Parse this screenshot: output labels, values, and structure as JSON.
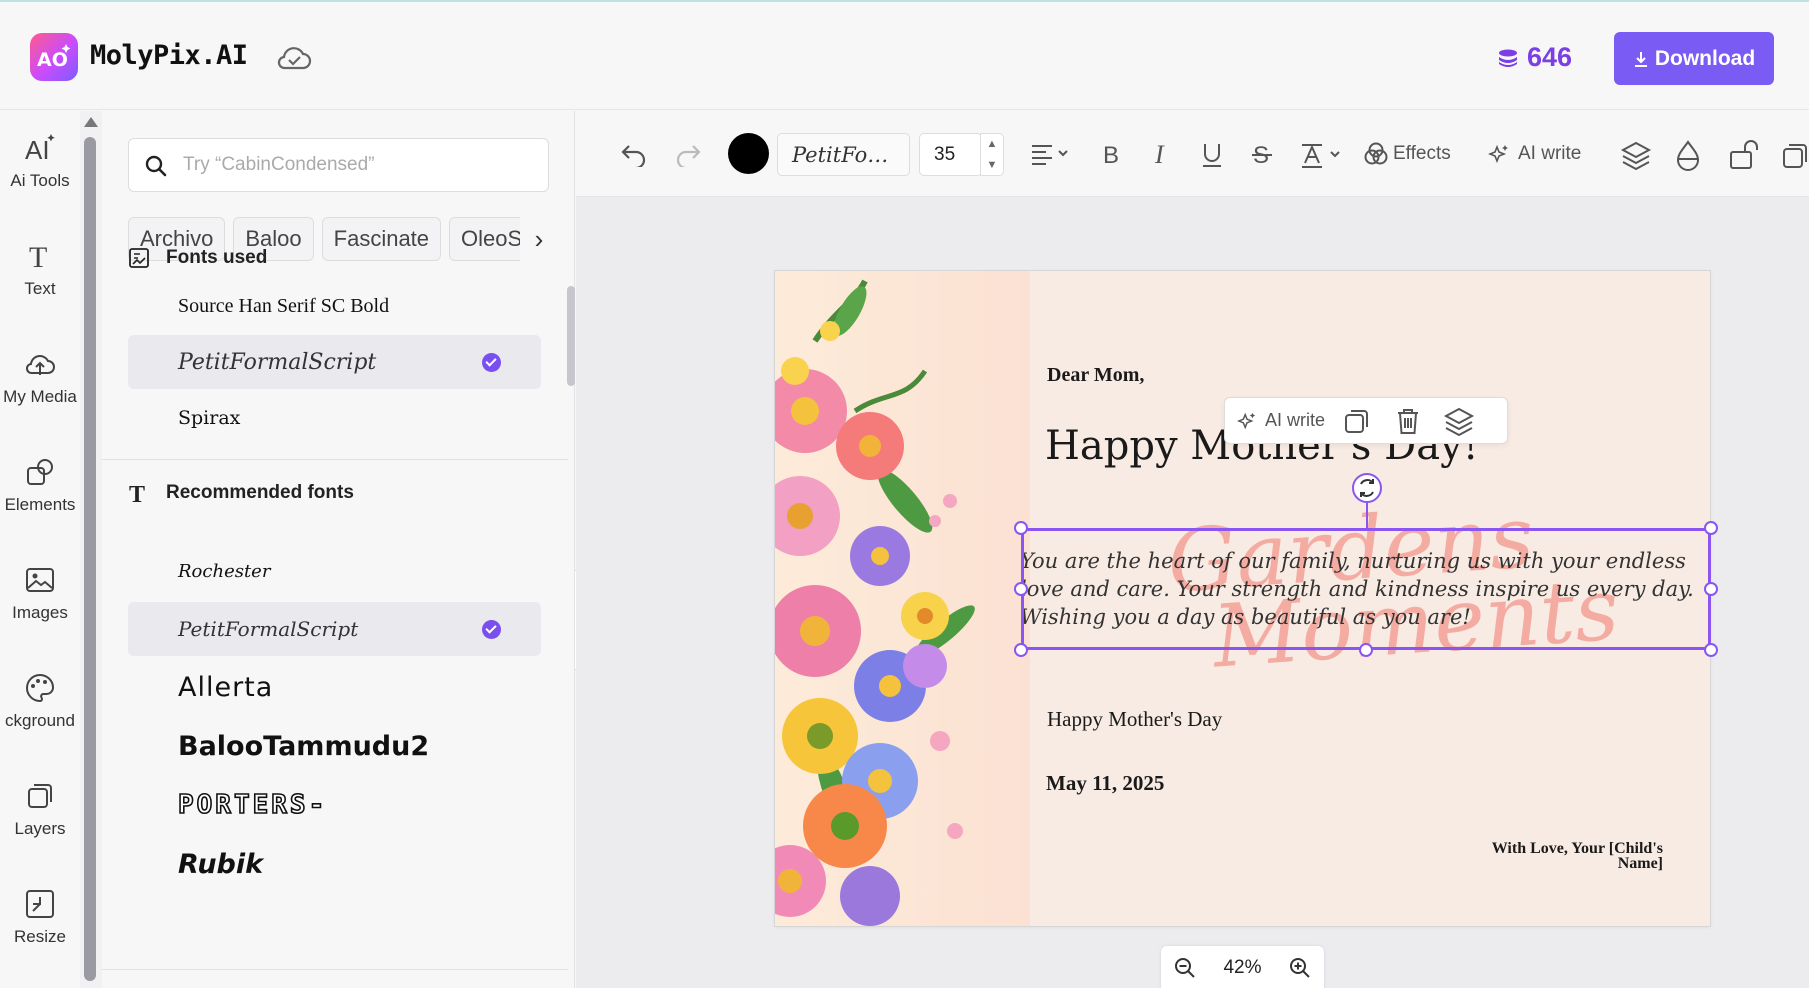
{
  "header": {
    "app_name": "MolyPix.AI",
    "logo_mark": "AO",
    "credits": "646",
    "download_label": "Download"
  },
  "rail": {
    "items": [
      {
        "label": "Ai Tools",
        "icon": "ai-tools-icon"
      },
      {
        "label": "Text",
        "icon": "text-icon"
      },
      {
        "label": "My Media",
        "icon": "upload-cloud-icon"
      },
      {
        "label": "Elements",
        "icon": "elements-icon"
      },
      {
        "label": "Images",
        "icon": "image-icon"
      },
      {
        "label": "ckground",
        "icon": "palette-icon"
      },
      {
        "label": "Layers",
        "icon": "layers-icon"
      },
      {
        "label": "Resize",
        "icon": "resize-icon"
      }
    ]
  },
  "panel": {
    "search_placeholder": "Try “CabinCondensed”",
    "chips": [
      "Archivo",
      "Baloo",
      "Fascinate",
      "OleoS"
    ],
    "fonts_used_title": "Fonts used",
    "fonts_used": [
      "Source Han Serif SC Bold",
      "PetitFormalScript",
      "Spirax"
    ],
    "recommended_title": "Recommended fonts",
    "recommended": [
      "Rochester",
      "PetitFormalScript",
      "Allerta",
      "BalooTammudu2",
      "PORTERS-",
      "Rubik"
    ]
  },
  "toolbar": {
    "font_name": "PetitFo…",
    "font_size": "35",
    "effects_label": "Effects",
    "ai_write_label": "AI write",
    "color": "#000000"
  },
  "card": {
    "greeting": "Dear Mom,",
    "heading": "Happy Mother's Day!",
    "body_line1": "You are the heart of our family, nurturing us with your endless",
    "body_line2": "love and care. Your strength and kindness inspire us every day.",
    "body_line3": "Wishing you a day as beautiful as you are!",
    "watermark_line1": "Gardens",
    "watermark_line2": "Moments",
    "subtitle": "Happy Mother's Day",
    "date": "May 11, 2025",
    "signature_line1": "With Love, Your [Child's",
    "signature_line2": "Name]"
  },
  "mini_toolbar": {
    "ai_write_label": "AI write"
  },
  "zoom": {
    "level": "42%"
  },
  "colors": {
    "accent": "#7a5cf5",
    "credits": "#7b3fe4",
    "selection": "#8a55f0"
  }
}
